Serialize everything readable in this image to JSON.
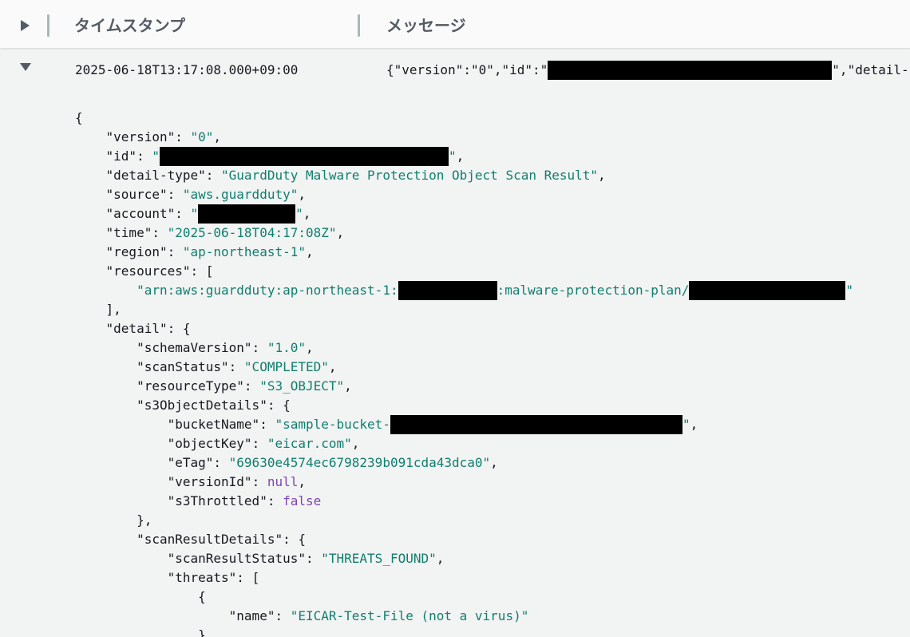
{
  "header": {
    "timestamp_label": "タイムスタンプ",
    "message_label": "メッセージ"
  },
  "log_row": {
    "timestamp": "2025-06-18T13:17:08.000+09:00",
    "preview_start": "{\"version\":\"0\",\"id\":\"",
    "preview_end": "\",\"detail-"
  },
  "json": {
    "open_brace": "{",
    "version_key": "\"version\"",
    "version_val": "\"0\"",
    "id_key": "\"id\"",
    "detail_type_key": "\"detail-type\"",
    "detail_type_val": "\"GuardDuty Malware Protection Object Scan Result\"",
    "source_key": "\"source\"",
    "source_val": "\"aws.guardduty\"",
    "account_key": "\"account\"",
    "time_key": "\"time\"",
    "time_val": "\"2025-06-18T04:17:08Z\"",
    "region_key": "\"region\"",
    "region_val": "\"ap-northeast-1\"",
    "resources_key": "\"resources\"",
    "arn_prefix": "\"arn:aws:guardduty:ap-northeast-1:",
    "arn_mid": ":malware-protection-plan/",
    "close_bracket": "],",
    "detail_key": "\"detail\"",
    "schema_version_key": "\"schemaVersion\"",
    "schema_version_val": "\"1.0\"",
    "scan_status_key": "\"scanStatus\"",
    "scan_status_val": "\"COMPLETED\"",
    "resource_type_key": "\"resourceType\"",
    "resource_type_val": "\"S3_OBJECT\"",
    "s3_object_details_key": "\"s3ObjectDetails\"",
    "bucket_name_key": "\"bucketName\"",
    "bucket_name_prefix": "\"sample-bucket-",
    "object_key_key": "\"objectKey\"",
    "object_key_val": "\"eicar.com\"",
    "etag_key": "\"eTag\"",
    "etag_val": "\"69630e4574ec6798239b091cda43dca0\"",
    "version_id_key": "\"versionId\"",
    "version_id_val": "null",
    "s3_throttled_key": "\"s3Throttled\"",
    "s3_throttled_val": "false",
    "close_obj_comma": "},",
    "scan_result_details_key": "\"scanResultDetails\"",
    "scan_result_status_key": "\"scanResultStatus\"",
    "scan_result_status_val": "\"THREATS_FOUND\"",
    "threats_key": "\"threats\"",
    "threat_name_key": "\"name\"",
    "threat_name_val": "\"EICAR-Test-File (not a virus)\"",
    "close_obj": "}"
  }
}
